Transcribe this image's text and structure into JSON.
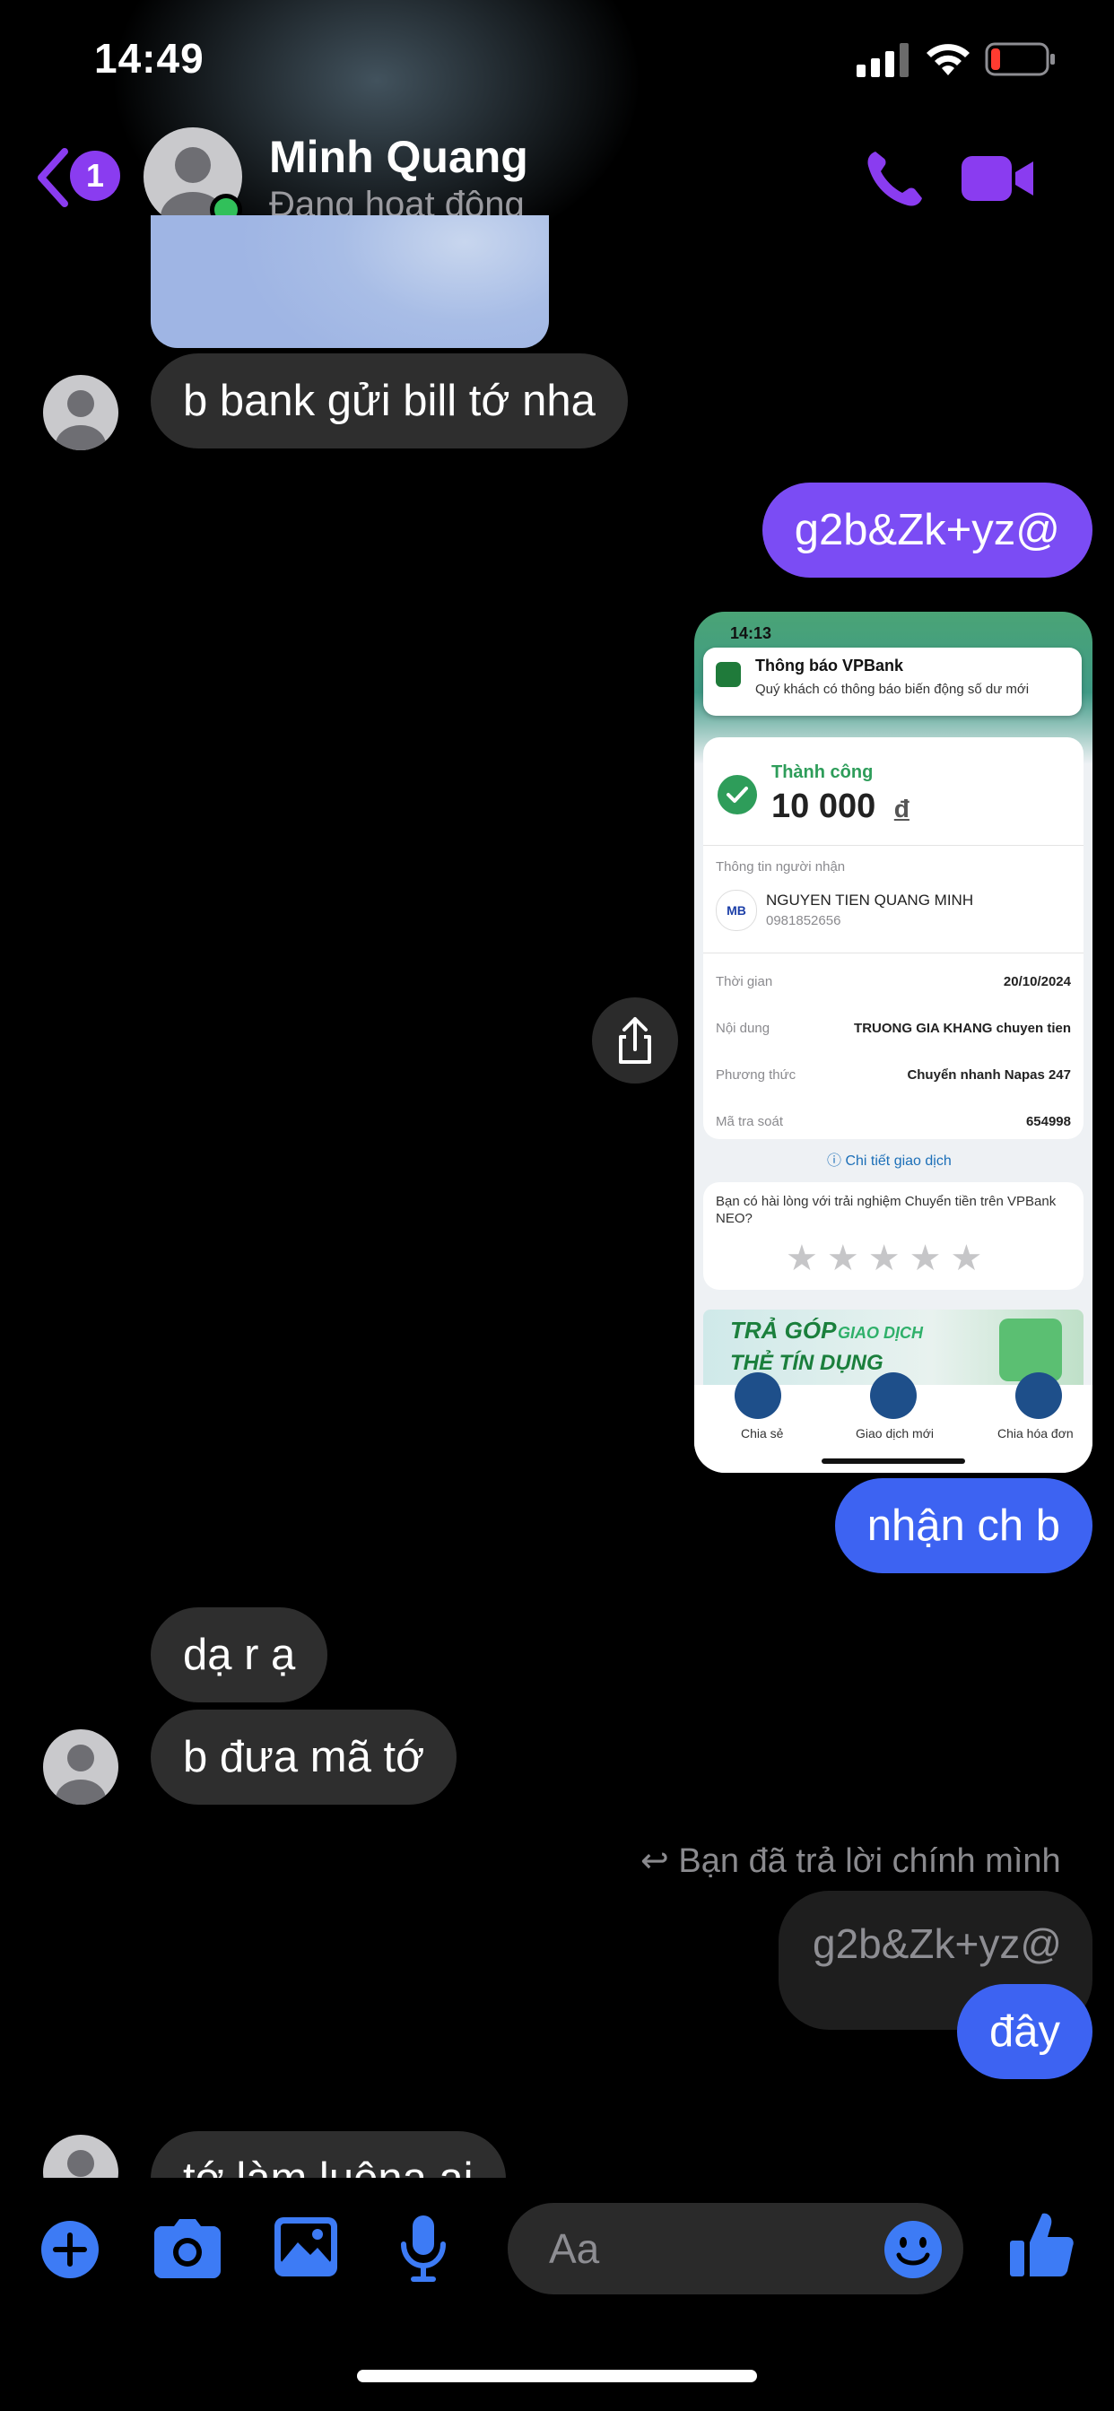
{
  "status_bar": {
    "time": "14:49"
  },
  "header": {
    "back_badge": "1",
    "contact_name": "Minh Quang",
    "contact_status": "Đang hoạt động"
  },
  "messages": {
    "m1": "b bank gửi bill tớ nha",
    "m2": "g2b&Zk+yz@",
    "m3": "nhận ch b",
    "m4": "dạ r ạ",
    "m5": "b đưa mã tớ",
    "reply_note": "Bạn đã trả lời chính mình",
    "quoted": "g2b&Zk+yz@",
    "m6": "đây",
    "m7": "tớ làm luôna ai"
  },
  "receipt": {
    "time": "14:13",
    "notif_title": "Thông báo VPBank",
    "notif_body": "Quý khách có thông báo biến động số dư mới",
    "status": "Thành công",
    "amount": "10 000",
    "currency": "đ",
    "recipient_label": "Thông tin người nhận",
    "bank_logo": "MB",
    "recipient_name": "NGUYEN TIEN QUANG MINH",
    "recipient_account": "0981852656",
    "rows": [
      {
        "label": "Thời gian",
        "value": "20/10/2024"
      },
      {
        "label": "Nội dung",
        "value": "TRUONG GIA KHANG chuyen tien"
      },
      {
        "label": "Phương thức",
        "value": "Chuyển nhanh Napas 247"
      },
      {
        "label": "Mã tra soát",
        "value": "654998"
      }
    ],
    "detail_link": "Chi tiết giao dịch",
    "rating_question": "Bạn có hài lòng với trải nghiệm Chuyển tiền trên VPBank NEO?",
    "banner_text_1": "TRẢ GÓP",
    "banner_text_2": "GIAO DỊCH",
    "banner_text_3": "THẺ TÍN DỤNG",
    "nav": [
      "Chia sẻ",
      "Giao dịch mới",
      "Chia hóa đơn"
    ]
  },
  "composer": {
    "placeholder": "Aa"
  },
  "colors": {
    "accent_purple": "#8a3cf0",
    "bubble_purple": "#7b4cf4",
    "bubble_blue": "#3d63f2",
    "bubble_incoming": "#2e2e2e",
    "toolbar_blue": "#3d7bf5",
    "online_green": "#31c05a"
  },
  "icons": {
    "back": "chevron-left-icon",
    "call": "phone-icon",
    "video": "video-camera-icon",
    "share": "share-icon",
    "add": "plus-circle-icon",
    "camera": "camera-icon",
    "gallery": "image-icon",
    "mic": "microphone-icon",
    "emoji": "smiley-icon",
    "like": "thumbs-up-icon"
  }
}
